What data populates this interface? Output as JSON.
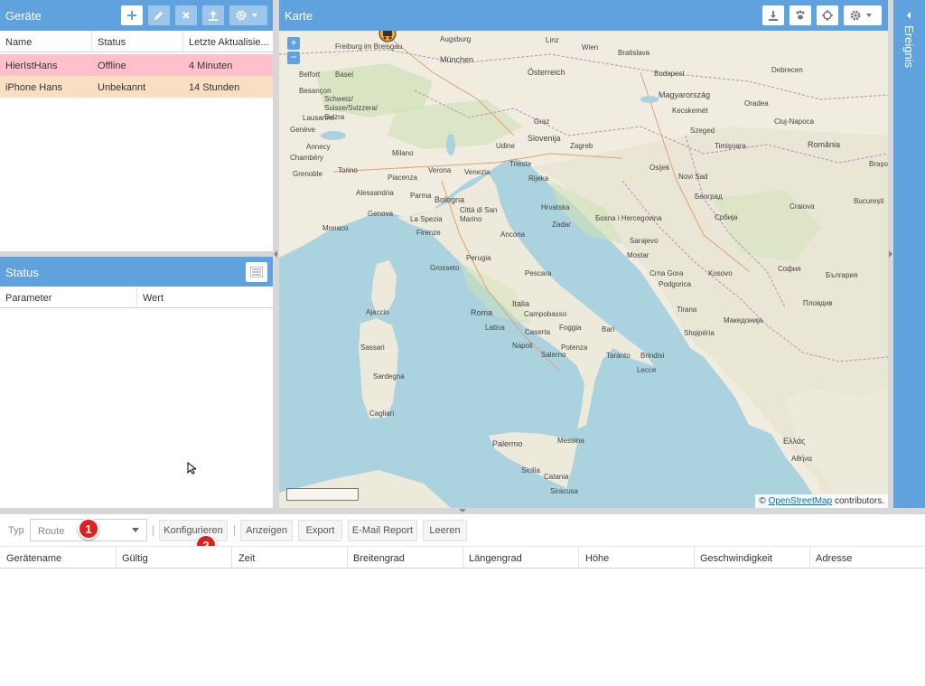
{
  "devices": {
    "title": "Geräte",
    "columns": [
      "Name",
      "Status",
      "Letzte Aktualisie..."
    ],
    "rows": [
      {
        "name": "HierIstHans",
        "status": "Offline",
        "updated": "4 Minuten",
        "color": "#ffc0cb"
      },
      {
        "name": "iPhone Hans",
        "status": "Unbekannt",
        "updated": "14 Stunden",
        "color": "#f9dfc2"
      }
    ],
    "toolbar_icons": [
      "plus-icon",
      "pencil-icon",
      "close-icon",
      "upload-icon",
      "gear-icon"
    ]
  },
  "status_panel": {
    "title": "Status",
    "columns": [
      "Parameter",
      "Wert"
    ]
  },
  "map": {
    "title": "Karte",
    "zoom_in": "+",
    "zoom_out": "−",
    "attribution_prefix": "© ",
    "attribution_link": "OpenStreetMap",
    "attribution_suffix": " contributors.",
    "toolbar_icons": [
      "download-icon",
      "paw-icon",
      "crosshair-icon",
      "gear-icon"
    ],
    "labels": [
      {
        "t": "Augsburg"
      },
      {
        "t": "München"
      },
      {
        "t": "Freiburg im Breisgau"
      },
      {
        "t": "Basel"
      },
      {
        "t": "Belfort"
      },
      {
        "t": "Besançon"
      },
      {
        "t": "Schweiz/ Suisse/Svizzera/ Svizra"
      },
      {
        "t": "Lausanne"
      },
      {
        "t": "Genève"
      },
      {
        "t": "Annecy"
      },
      {
        "t": "Chambéry"
      },
      {
        "t": "Grenoble"
      },
      {
        "t": "Torino"
      },
      {
        "t": "Milano"
      },
      {
        "t": "Verona"
      },
      {
        "t": "Venezia"
      },
      {
        "t": "Trieste"
      },
      {
        "t": "Udine"
      },
      {
        "t": "Piacenza"
      },
      {
        "t": "Alessandria"
      },
      {
        "t": "Parma"
      },
      {
        "t": "Bologna"
      },
      {
        "t": "Genova"
      },
      {
        "t": "La Spezia"
      },
      {
        "t": "Monaco"
      },
      {
        "t": "Firenze"
      },
      {
        "t": "Città di San Marino"
      },
      {
        "t": "Ancona"
      },
      {
        "t": "Rijeka"
      },
      {
        "t": "Hrvatska"
      },
      {
        "t": "Zadar"
      },
      {
        "t": "Grosseto"
      },
      {
        "t": "Perugia"
      },
      {
        "t": "Pescara"
      },
      {
        "t": "Roma"
      },
      {
        "t": "Italia"
      },
      {
        "t": "Campobasso"
      },
      {
        "t": "Foggia"
      },
      {
        "t": "Bari"
      },
      {
        "t": "Latina"
      },
      {
        "t": "Napoli"
      },
      {
        "t": "Caserta"
      },
      {
        "t": "Salerno"
      },
      {
        "t": "Potenza"
      },
      {
        "t": "Taranto"
      },
      {
        "t": "Brindisi"
      },
      {
        "t": "Lecce"
      },
      {
        "t": "Ajaccio"
      },
      {
        "t": "Sassari"
      },
      {
        "t": "Sardegna"
      },
      {
        "t": "Cagliari"
      },
      {
        "t": "Palermo"
      },
      {
        "t": "Sicilia"
      },
      {
        "t": "Messina"
      },
      {
        "t": "Catania"
      },
      {
        "t": "Siracusa"
      },
      {
        "t": "Linz"
      },
      {
        "t": "Wien"
      },
      {
        "t": "Österreich"
      },
      {
        "t": "Bratislava"
      },
      {
        "t": "Budapest"
      },
      {
        "t": "Magyarország"
      },
      {
        "t": "Graz"
      },
      {
        "t": "Slovenija"
      },
      {
        "t": "Zagreb"
      },
      {
        "t": "Szeged"
      },
      {
        "t": "Timișoara"
      },
      {
        "t": "Osijek"
      },
      {
        "t": "Novi Sad"
      },
      {
        "t": "Београд"
      },
      {
        "t": "Бosna i Hercegovina"
      },
      {
        "t": "Sarajevo"
      },
      {
        "t": "Србија"
      },
      {
        "t": "Mostar"
      },
      {
        "t": "Crna Gora"
      },
      {
        "t": "Podgorica"
      },
      {
        "t": "Kosovo"
      },
      {
        "t": "Shqipëria"
      },
      {
        "t": "Tirana"
      },
      {
        "t": "Македонија"
      },
      {
        "t": "България"
      },
      {
        "t": "София"
      },
      {
        "t": "Пловдив"
      },
      {
        "t": "România"
      },
      {
        "t": "Cluj-Napoca"
      },
      {
        "t": "Craiova"
      },
      {
        "t": "București"
      },
      {
        "t": "Brașov"
      },
      {
        "t": "Oradea"
      },
      {
        "t": "Debrecen"
      },
      {
        "t": "Kecskemét"
      },
      {
        "t": "Ελλάς"
      },
      {
        "t": "Αθήνα"
      }
    ]
  },
  "events": {
    "title": "Ereignis"
  },
  "report": {
    "type_label": "Typ",
    "type_value": "Route",
    "buttons": {
      "configure": "Konfigurieren",
      "show": "Anzeigen",
      "export": "Export",
      "email": "E-Mail Report",
      "clear": "Leeren"
    },
    "badge1": "1",
    "badge2": "2",
    "columns": [
      "Gerätename",
      "Gültig",
      "Zeit",
      "Breitengrad",
      "Längengrad",
      "Höhe",
      "Geschwindigkeit",
      "Adresse"
    ]
  }
}
